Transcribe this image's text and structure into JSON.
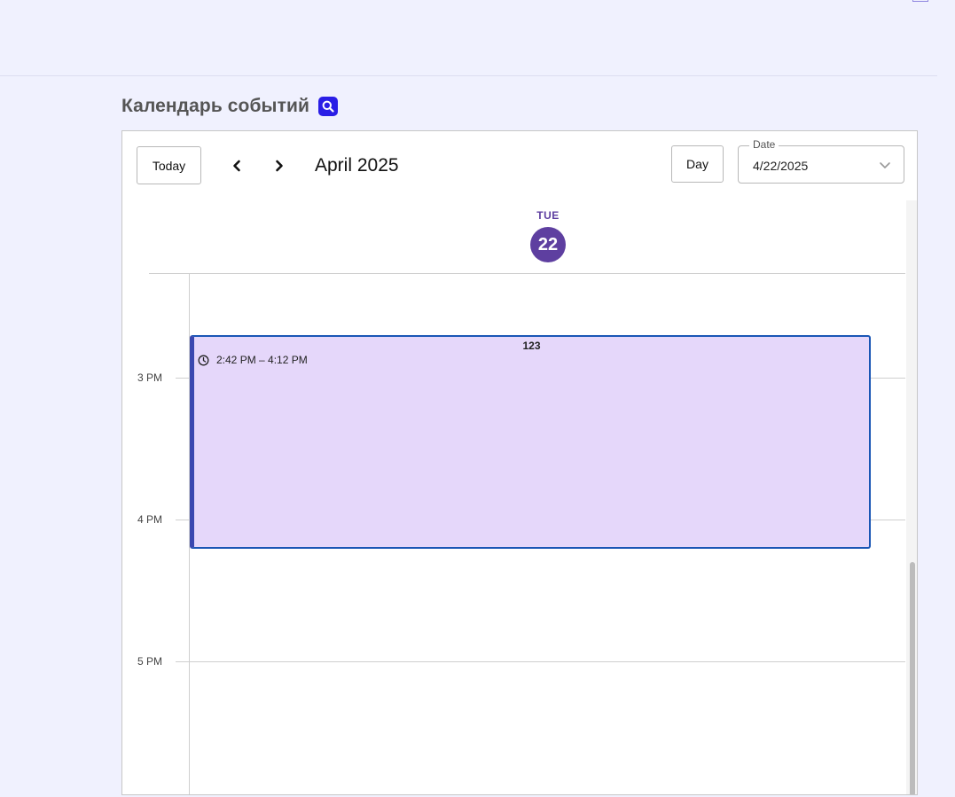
{
  "page": {
    "title": "Календарь событий",
    "search_icon": "search-icon"
  },
  "toolbar": {
    "today_label": "Today",
    "prev_icon": "chevron-left-icon",
    "next_icon": "chevron-right-icon",
    "month_label": "April 2025",
    "view_label": "Day",
    "date_field_label": "Date",
    "date_value": "4/22/2025",
    "date_dropdown_icon": "chevron-down-icon"
  },
  "day_header": {
    "weekday": "TUE",
    "day_number": "22"
  },
  "time_slots": [
    {
      "label": "3 PM"
    },
    {
      "label": "4 PM"
    },
    {
      "label": "5 PM"
    }
  ],
  "event": {
    "title": "123",
    "time_range": "2:42 PM – 4:12 PM",
    "time_icon": "clock-icon"
  },
  "colors": {
    "background": "#f0f1fe",
    "accent": "#5e3fa0",
    "event_fill": "#e5d7fa",
    "event_border": "#1a56b5",
    "search_button": "#2a1ee6"
  }
}
